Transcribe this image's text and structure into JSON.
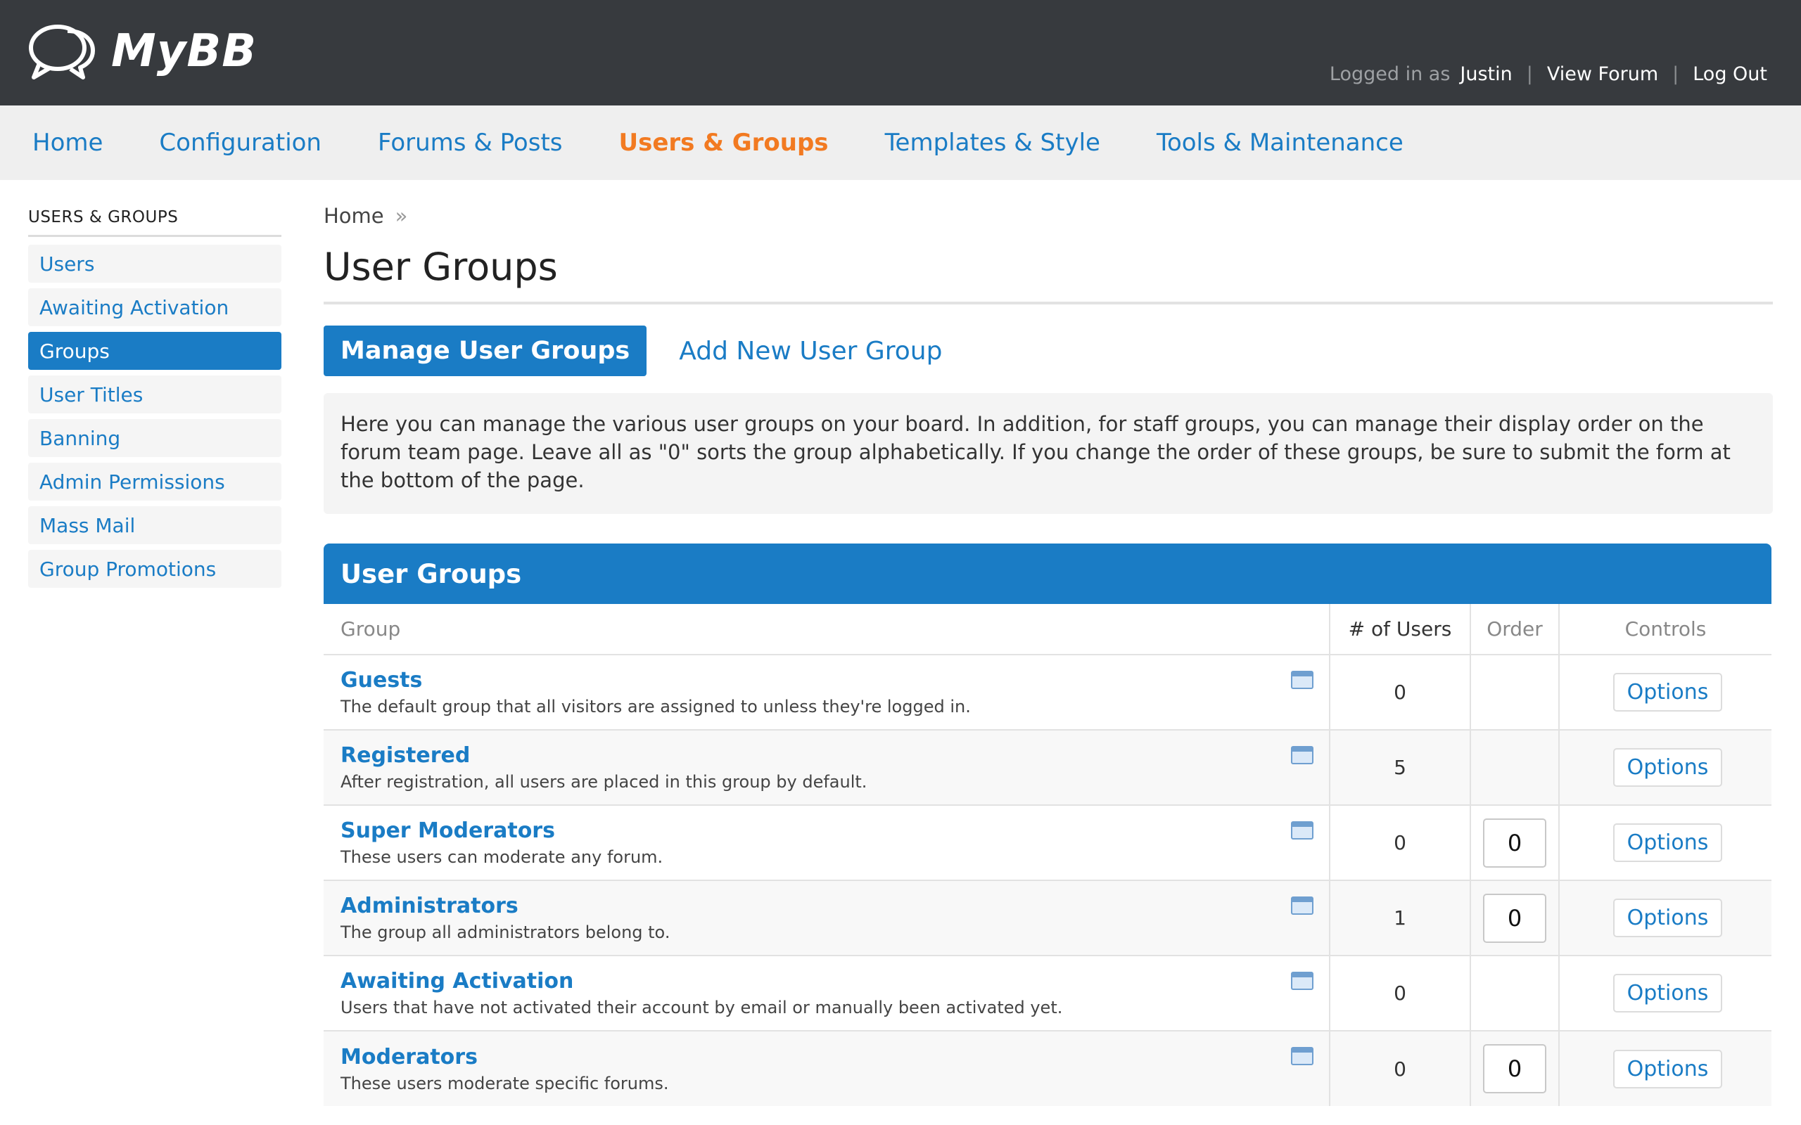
{
  "header": {
    "logo_text": "MyBB",
    "logged_in_label": "Logged in as",
    "username": "Justin",
    "separator": "|",
    "view_forum": "View Forum",
    "log_out": "Log Out"
  },
  "topnav": {
    "items": [
      "Home",
      "Configuration",
      "Forums & Posts",
      "Users & Groups",
      "Templates & Style",
      "Tools & Maintenance"
    ],
    "active": "Users & Groups"
  },
  "sidebar": {
    "title": "USERS & GROUPS",
    "items": [
      "Users",
      "Awaiting Activation",
      "Groups",
      "User Titles",
      "Banning",
      "Admin Permissions",
      "Mass Mail",
      "Group Promotions"
    ],
    "active": "Groups"
  },
  "breadcrumb": {
    "home": "Home",
    "raquo": "»"
  },
  "page_title": "User Groups",
  "tabs": {
    "manage": "Manage User Groups",
    "add": "Add New User Group"
  },
  "notice": "Here you can manage the various user groups on your board. In addition, for staff groups, you can manage their display order on the forum team page. Leave all as \"0\" sorts the group alphabetically. If you change the order of these groups, be sure to submit the form at the bottom of the page.",
  "table": {
    "title": "User Groups",
    "columns": {
      "group": "Group",
      "users": "# of Users",
      "order": "Order",
      "controls": "Controls"
    },
    "options_label": "Options",
    "rows": [
      {
        "name": "Guests",
        "desc": "The default group that all visitors are assigned to unless they're logged in.",
        "users": "0",
        "order": ""
      },
      {
        "name": "Registered",
        "desc": "After registration, all users are placed in this group by default.",
        "users": "5",
        "order": ""
      },
      {
        "name": "Super Moderators",
        "desc": "These users can moderate any forum.",
        "users": "0",
        "order": "0"
      },
      {
        "name": "Administrators",
        "desc": "The group all administrators belong to.",
        "users": "1",
        "order": "0"
      },
      {
        "name": "Awaiting Activation",
        "desc": "Users that have not activated their account by email or manually been activated yet.",
        "users": "0",
        "order": ""
      },
      {
        "name": "Moderators",
        "desc": "These users moderate specific forums.",
        "users": "0",
        "order": "0"
      }
    ]
  },
  "icons": {
    "group_icon": "window-icon",
    "logo_icon": "speech-bubbles-icon"
  },
  "colors": {
    "accent": "#1a7cc5",
    "active_nav": "#f27a21",
    "header_bg": "#373a3e"
  }
}
